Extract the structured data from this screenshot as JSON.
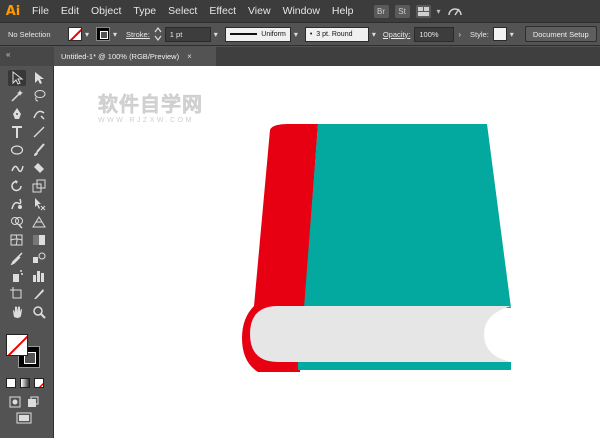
{
  "menubar": {
    "logo": "Ai",
    "items": [
      "File",
      "Edit",
      "Object",
      "Type",
      "Select",
      "Effect",
      "View",
      "Window",
      "Help"
    ],
    "apps": [
      "Br",
      "St"
    ]
  },
  "controlbar": {
    "selection_label": "No Selection",
    "stroke_label": "Stroke:",
    "stroke_weight": "1 pt",
    "profile_label": "Uniform",
    "brush_label": "3 pt. Round",
    "opacity_label": "Opacity:",
    "opacity_value": "100%",
    "style_label": "Style:",
    "doc_setup_label": "Document Setup"
  },
  "tab": {
    "title": "Untitled-1* @ 100% (RGB/Preview)",
    "close": "×"
  },
  "toolbar": {
    "collapse": "«",
    "tools": [
      "selection-tool",
      "direct-selection-tool",
      "magic-wand-tool",
      "lasso-tool",
      "pen-tool",
      "curvature-tool",
      "type-tool",
      "line-tool",
      "ellipse-tool",
      "paintbrush-tool",
      "shaper-tool",
      "eraser-tool",
      "rotate-tool",
      "scale-tool",
      "warp-tool",
      "free-transform-tool",
      "shape-builder-tool",
      "perspective-grid-tool",
      "mesh-tool",
      "gradient-tool",
      "eyedropper-tool",
      "blend-tool",
      "symbol-sprayer-tool",
      "column-graph-tool",
      "artboard-tool",
      "slice-tool",
      "hand-tool",
      "zoom-tool"
    ]
  },
  "canvas": {
    "watermark_main": "软件自学网",
    "watermark_sub": "WWW.RJZXW.COM"
  },
  "colors": {
    "book_cover": "#03a89e",
    "book_spine": "#e60012",
    "book_pages": "#e6e6e6",
    "app_dark": "#535353",
    "menu_dark": "#3c3c3c",
    "ai_orange": "#ff9a00"
  }
}
